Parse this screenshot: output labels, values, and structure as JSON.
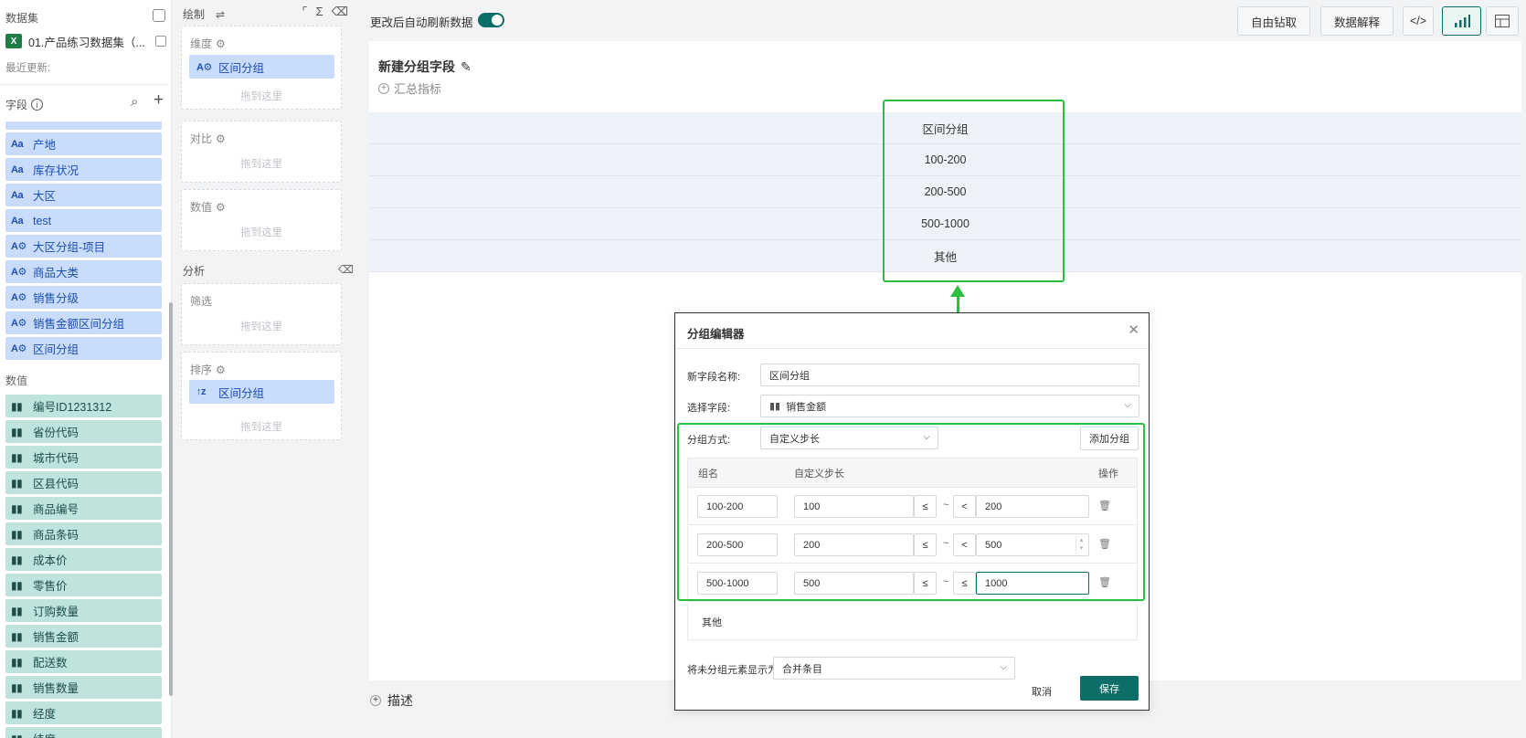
{
  "dataset_panel": {
    "title": "数据集",
    "dataset_name": "01.产品练习数据集（...",
    "updated_label": "最近更新:",
    "fields_label": "字段",
    "dimension_fields": [
      "产地",
      "库存状况",
      "大区",
      "test",
      "大区分组-项目",
      "商品大类",
      "销售分级",
      "销售金额区间分组",
      "区间分组"
    ],
    "dimension_icons": [
      "Aa",
      "Aa",
      "Aa",
      "Aa",
      "A⚙",
      "A⚙",
      "A⚙",
      "A⚙",
      "A⚙"
    ],
    "values_label": "数值",
    "measure_fields": [
      "编号ID1231312",
      "省份代码",
      "城市代码",
      "区县代码",
      "商品编号",
      "商品条码",
      "成本价",
      "零售价",
      "订购数量",
      "销售金额",
      "配送数",
      "销售数量",
      "经度",
      "纬度"
    ]
  },
  "config_panel": {
    "draw_label": "绘制",
    "dimension_zone": {
      "title": "维度",
      "pill": "区间分组",
      "drop": "拖到这里"
    },
    "compare_zone": {
      "title": "对比",
      "drop": "拖到这里"
    },
    "value_zone": {
      "title": "数值",
      "drop": "拖到这里"
    },
    "analysis_label": "分析",
    "filter_zone": {
      "title": "筛选",
      "drop": "拖到这里"
    },
    "sort_zone": {
      "title": "排序",
      "pill": "区间分组",
      "drop": "拖到这里"
    }
  },
  "toolbar": {
    "auto_refresh_label": "更改后自动刷新数据",
    "auto_refresh_on": true,
    "drill_button": "自由钻取",
    "explain_button": "数据解释",
    "code_button": "</>"
  },
  "chart": {
    "title": "新建分组字段",
    "summary_label": "汇总指标",
    "table_header": "区间分组",
    "table_rows": [
      "100-200",
      "200-500",
      "500-1000",
      "其他"
    ],
    "describe_label": "描述"
  },
  "dialog": {
    "title": "分组编辑器",
    "new_field_label": "新字段名称:",
    "new_field_value": "区间分组",
    "select_field_label": "选择字段:",
    "select_field_value": "销售金额",
    "group_method_label": "分组方式:",
    "group_method_value": "自定义步长",
    "add_group_button": "添加分组",
    "col_group_name": "组名",
    "col_step": "自定义步长",
    "col_action": "操作",
    "groups": [
      {
        "name": "100-200",
        "min": "100",
        "op_left": "≤",
        "op_right": "<",
        "max": "200"
      },
      {
        "name": "200-500",
        "min": "200",
        "op_left": "≤",
        "op_right": "<",
        "max": "500"
      },
      {
        "name": "500-1000",
        "min": "500",
        "op_left": "≤",
        "op_right": "≤",
        "max": "1000"
      }
    ],
    "other_group": "其他",
    "ungrouped_label": "将未分组元素显示为:",
    "ungrouped_value": "合并条目",
    "cancel_button": "取消",
    "save_button": "保存"
  },
  "colors": {
    "accent": "#0d6e68",
    "highlight": "#2bc03f",
    "dimension_bg": "#c9dcfb",
    "measure_bg": "#bfe3dd"
  }
}
